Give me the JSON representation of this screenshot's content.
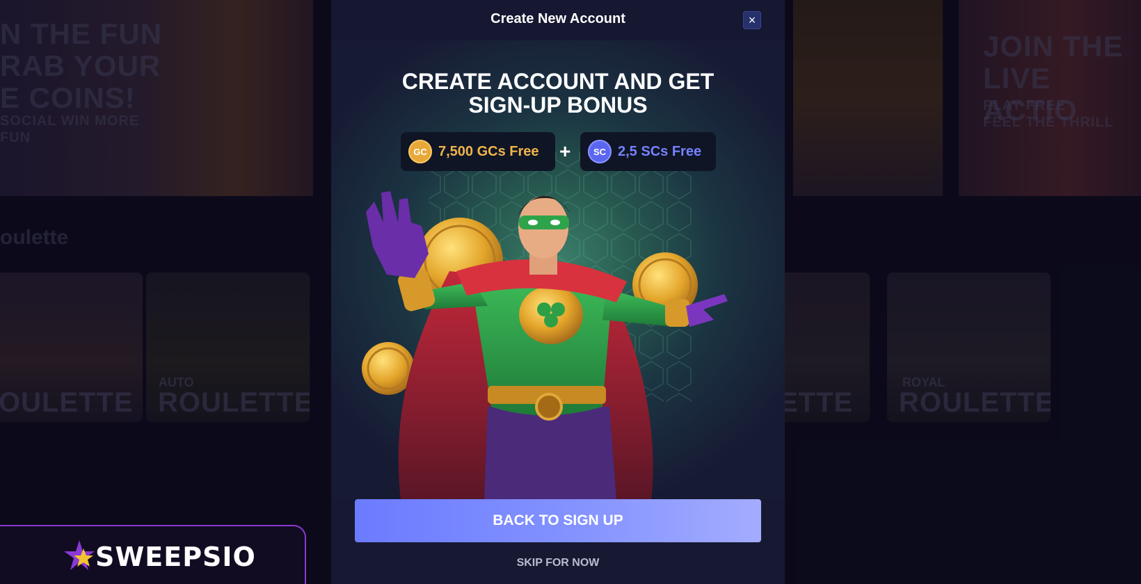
{
  "background": {
    "promo_left": {
      "title_lines": [
        "N THE FUN",
        "RAB YOUR",
        "E COINS!"
      ],
      "sub_lines": [
        "SOCIAL WIN MORE",
        "FUN"
      ]
    },
    "promo_right": {
      "title_lines": [
        "JOIN THE",
        "LIVE ACTIO"
      ],
      "sub_lines": [
        "PLAY FREE",
        "FEEL THE THRILL"
      ]
    },
    "section_title": "oulette",
    "tiles": [
      {
        "small": "",
        "big": "OULETTE"
      },
      {
        "small": "AUTO",
        "big": "ROULETTE"
      },
      {
        "small": "",
        "big": "ETTE"
      },
      {
        "small": "ROYAL",
        "big": "ROULETTE"
      }
    ]
  },
  "logo": {
    "text": "SWEEPSIO"
  },
  "modal": {
    "title": "Create New Account",
    "close_label": "×",
    "headline_lines": [
      "CREATE ACCOUNT AND GET",
      "SIGN-UP BONUS"
    ],
    "bonuses": [
      {
        "coin": "GC",
        "label": "7,500 GCs Free",
        "color": "#f0b44a",
        "coin_color": "#e8a838"
      },
      {
        "coin": "SC",
        "label": "2,5 SCs Free",
        "color": "#7682ff",
        "coin_color": "#5b66f0"
      }
    ],
    "plus": "+",
    "cta_label": "BACK TO SIGN UP",
    "skip_label": "SKIP FOR NOW"
  },
  "colors": {
    "accent": "#7a89ff",
    "logo_border": "#8a39d6",
    "modal_bg": "#171933"
  }
}
